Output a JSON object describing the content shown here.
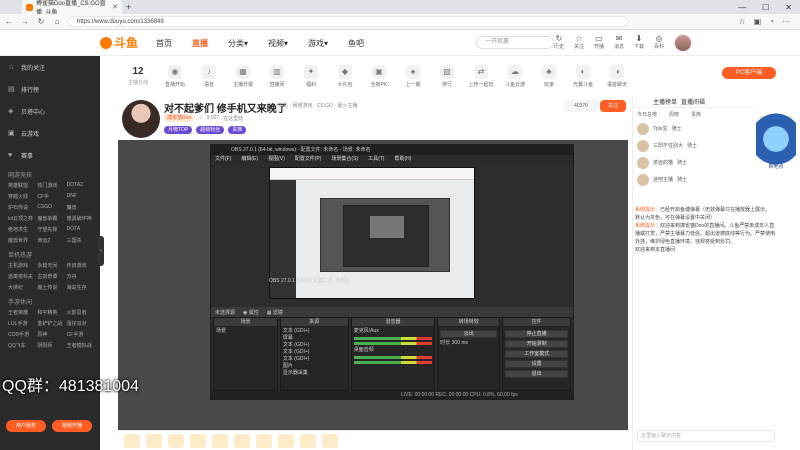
{
  "browser": {
    "tab_title": "搏雀猫Doo直播_CS:GO直播_斗鱼",
    "url": "https://www.douyu.com/1336849",
    "nav": [
      "←",
      "→",
      "↻",
      "⌂"
    ],
    "window_controls": [
      "—",
      "☐",
      "✕"
    ]
  },
  "header": {
    "logo": "斗鱼",
    "nav": [
      "首页",
      "直播",
      "分类▾",
      "视频▾",
      "游戏▾",
      "鱼吧"
    ],
    "active_nav": "直播",
    "search_placeholder": "一开就赢",
    "icons": [
      {
        "icon": "↻",
        "label": "历史"
      },
      {
        "icon": "☆",
        "label": "关注"
      },
      {
        "icon": "▭",
        "label": "开播"
      },
      {
        "icon": "✉",
        "label": "消息"
      },
      {
        "icon": "⬇",
        "label": "下载"
      },
      {
        "icon": "◎",
        "label": "百科"
      }
    ]
  },
  "sidebar": {
    "items": [
      {
        "icon": "☆",
        "label": "我的关注"
      },
      {
        "icon": "▤",
        "label": "排行榜"
      },
      {
        "icon": "◈",
        "label": "贝塔中心"
      },
      {
        "icon": "▣",
        "label": "云游戏"
      },
      {
        "icon": "♥",
        "label": "赛事"
      }
    ],
    "sections": [
      {
        "title": "网游竞技",
        "items": [
          "英雄联盟",
          "热门游戏",
          "DOTA2",
          "穿越火线",
          "CF手",
          "DNF",
          "炉石传说",
          "CSGO",
          "魔兽",
          "lol云顶之弈",
          "魔兽争霸",
          "暗黑破坏神",
          "绝地求生",
          "守望先锋",
          "DOTA",
          "魔兽世界",
          "命运2",
          "三国杀"
        ]
      },
      {
        "title": "单机热游",
        "items": [
          "主机游戏",
          "永劫无间",
          "怀旧游戏",
          "逃离塔科夫",
          "古剑奇谭",
          "方舟",
          "大侠纪",
          "魔土传说",
          "海岛生存"
        ]
      },
      {
        "title": "手游休闲",
        "items": [
          "王者荣耀",
          "和平精英",
          "火影忍者",
          "LOL手游",
          "金铲铲之战",
          "蛋仔派对",
          "COD手游",
          "原神",
          "CF手游",
          "QQ飞车",
          "阴阳师",
          "王者模拟战"
        ]
      }
    ],
    "buttons": [
      "用户服务",
      "视频开播"
    ]
  },
  "categories": {
    "online_count": "12",
    "online_label": "主播在线",
    "items": [
      {
        "icon": "◉",
        "label": "直播开始"
      },
      {
        "icon": "♪",
        "label": "语音"
      },
      {
        "icon": "▦",
        "label": "主播日报"
      },
      {
        "icon": "▥",
        "label": "直播间"
      },
      {
        "icon": "✦",
        "label": "福利"
      },
      {
        "icon": "◆",
        "label": "大礼包"
      },
      {
        "icon": "▣",
        "label": "全新PK"
      },
      {
        "icon": "♠",
        "label": "上一期"
      },
      {
        "icon": "▧",
        "label": "排行"
      },
      {
        "icon": "⇄",
        "label": "上传一起玩"
      },
      {
        "icon": "☁",
        "label": "斗鱼云游"
      },
      {
        "icon": "♣",
        "label": "玩家"
      },
      {
        "icon": "◐",
        "label": "光翼斗鱼"
      },
      {
        "icon": "◑",
        "label": "语音聊天"
      }
    ],
    "pc_button": "PC客户端"
  },
  "streamer": {
    "title": "对不起爹们 修手机又来晚了",
    "category_tags": "单机 · 网络游戏 · CS:GO · 最火主播",
    "name_tag": "搏雀猫Doo",
    "heat": "9,027",
    "extra": "在这里玩",
    "fans": "40370",
    "follow": "关注",
    "badges": [
      "月榜TOP",
      "超级粉丝",
      "贵族"
    ]
  },
  "obs": {
    "title": "OBS 27.0.1 (64-bit, windows) - 配置文件: 未命名 - 场景: 未命名",
    "menu": [
      "文件(F)",
      "编辑(E)",
      "视图(V)",
      "配置文件(P)",
      "场景集合(S)",
      "工具(T)",
      "帮助(H)"
    ],
    "preview_label": "OBS 27.0.1 (64-bit) 配置文件 未命名",
    "toolbar": [
      "未选择源",
      "◉ 属性",
      "▦ 滤镜"
    ],
    "docks": [
      {
        "head": "场景",
        "rows": [
          "场景"
        ]
      },
      {
        "head": "来源",
        "rows": [
          "文本 (GDI+)",
          "屏幕",
          "文本 (GDI+)",
          "文本 (GDI+)",
          "文本 (GDI+)",
          "图片",
          "显示器采集"
        ]
      },
      {
        "head": "混音器",
        "rows": [
          "麦克风/Aux",
          "桌面音频"
        ]
      },
      {
        "head": "转场特效",
        "rows": [
          "淡出",
          "时长 300 ms"
        ]
      },
      {
        "head": "控件",
        "rows": [
          "停止直播",
          "开始录制",
          "工作室模式",
          "设置",
          "退出"
        ]
      }
    ],
    "status": "LIVE: 00:00:00   REC: 00:00:00   CPU: 0.8%, 60.00 fps"
  },
  "overlay": {
    "qq_group": "QQ群：481381004"
  },
  "chat": {
    "tabs": [
      "主播榜单",
      "直播间福"
    ],
    "subtabs": [
      "今日总榜",
      "周榜",
      "贵族"
    ],
    "ranks": [
      {
        "name": "Tpls宝",
        "title": "骑士"
      },
      {
        "name": "三阳不住别大",
        "title": "骑士"
      },
      {
        "name": "遂远的猫",
        "title": "骑士"
      },
      {
        "name": "迷吧主播",
        "title": "骑士"
      }
    ],
    "messages": [
      {
        "label": "系统提示：",
        "text": "已经开启鱼塘弹幕（无效弹幕只在播放器上展示，默认为灰色，可在弹幕设置中关闭）"
      },
      {
        "label": "系统提示：",
        "text": "欢迎来到搏雀猫Doo的直播间。斗鱼严禁未成年人直播或打赏，严禁主播暴力低俗、超出道德底线等行为。严禁使用外挂，维护绿色直播环境，违规将受到处罚。"
      },
      {
        "label": "",
        "text": "欢迎来到本直播间"
      }
    ],
    "input_placeholder": "这里输入聊天内容",
    "promo": "新地点"
  }
}
